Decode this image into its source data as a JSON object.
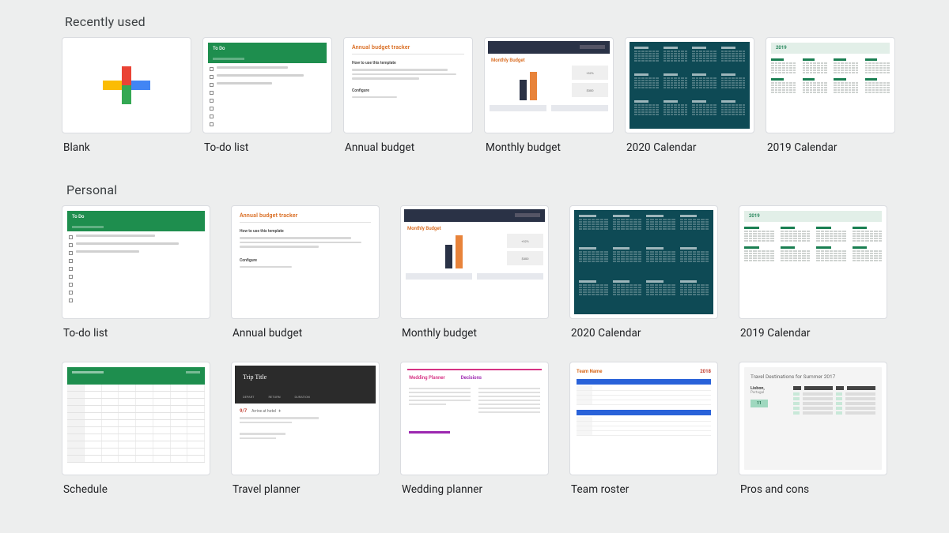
{
  "sections": {
    "recently_used": {
      "heading": "Recently used",
      "templates": [
        {
          "label": "Blank",
          "kind": "blank"
        },
        {
          "label": "To-do list",
          "kind": "todo",
          "heading_text": "To Do"
        },
        {
          "label": "Annual budget",
          "kind": "annual",
          "heading_text": "Annual budget tracker"
        },
        {
          "label": "Monthly budget",
          "kind": "monthly",
          "heading_text": "Monthly Budget"
        },
        {
          "label": "2020 Calendar",
          "kind": "cal2020"
        },
        {
          "label": "2019 Calendar",
          "kind": "cal2019",
          "year_text": "2019"
        }
      ]
    },
    "personal": {
      "heading": "Personal",
      "templates_row1": [
        {
          "label": "To-do list",
          "kind": "todo",
          "heading_text": "To Do"
        },
        {
          "label": "Annual budget",
          "kind": "annual",
          "heading_text": "Annual budget tracker"
        },
        {
          "label": "Monthly budget",
          "kind": "monthly",
          "heading_text": "Monthly Budget"
        },
        {
          "label": "2020 Calendar",
          "kind": "cal2020"
        },
        {
          "label": "2019 Calendar",
          "kind": "cal2019",
          "year_text": "2019"
        }
      ],
      "templates_row2": [
        {
          "label": "Schedule",
          "kind": "schedule"
        },
        {
          "label": "Travel planner",
          "kind": "travel",
          "heading_text": "Trip Title"
        },
        {
          "label": "Wedding planner",
          "kind": "wedding",
          "heading_text": "Wedding Planner",
          "sub_text": "Decisions"
        },
        {
          "label": "Team roster",
          "kind": "roster",
          "heading_text": "Team Name",
          "year_text": "2018"
        },
        {
          "label": "Pros and cons",
          "kind": "proscons",
          "heading_text": "Travel Destinations for Summer 2017",
          "city": "Lisbon,",
          "country": "Portugal",
          "badge": "11"
        }
      ]
    }
  },
  "colors": {
    "google_red": "#ea4335",
    "google_blue": "#4285f4",
    "google_green": "#34a853",
    "google_yellow": "#fbbc04",
    "sheets_green": "#1e8e4e",
    "accent_orange": "#d96b1f",
    "dark_teal": "#0e4a55",
    "navy": "#2a3246"
  }
}
